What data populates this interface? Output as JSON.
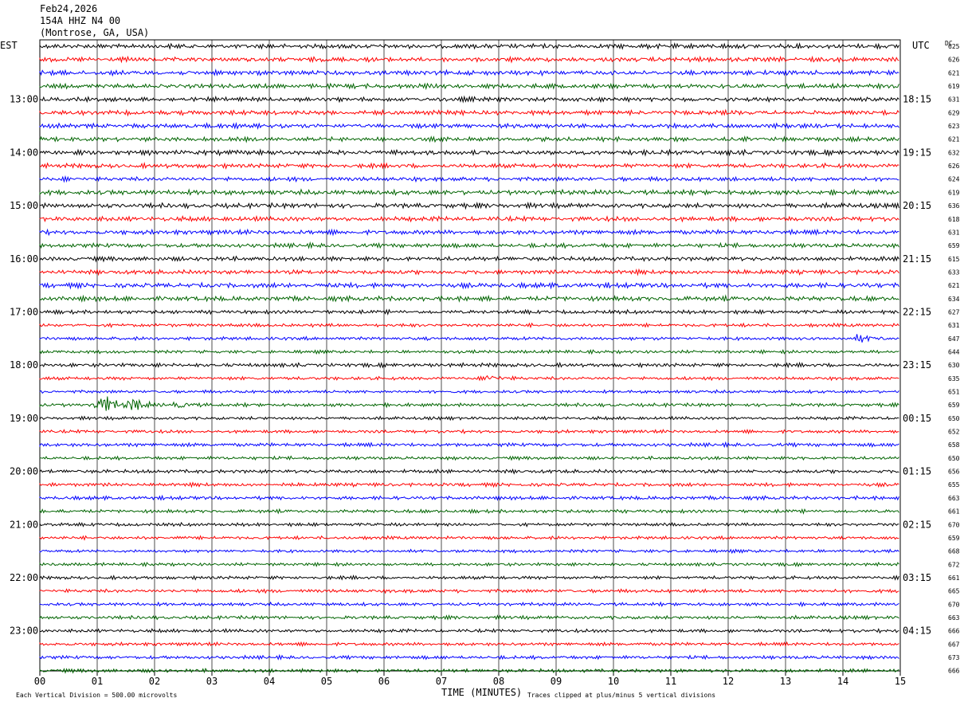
{
  "header": {
    "date": "Feb24,2026",
    "station": "154A HHZ N4 00",
    "location": "(Montrose, GA, USA)"
  },
  "left_axis_label": "EST",
  "right_axis_label": "UTC",
  "dc_label": "DC",
  "footer": {
    "scale_note": "Each Vertical Division =  500.00 microvolts",
    "xlabel": "TIME (MINUTES)",
    "clip_note": "Traces clipped at plus/minus 5 vertical divisions"
  },
  "chart_data": {
    "type": "line",
    "title": "",
    "xlabel": "TIME (MINUTES)",
    "x_ticks": [
      "00",
      "01",
      "02",
      "03",
      "04",
      "05",
      "06",
      "07",
      "08",
      "09",
      "10",
      "11",
      "12",
      "13",
      "14",
      "15"
    ],
    "xlim": [
      0,
      15
    ],
    "trace_colors": [
      "#000000",
      "#ff0000",
      "#0000ff",
      "#006400"
    ],
    "est_labels": [
      "13:00",
      "14:00",
      "15:00",
      "16:00",
      "17:00",
      "18:00",
      "19:00",
      "20:00",
      "21:00",
      "22:00",
      "23:00"
    ],
    "utc_labels": [
      "18:15",
      "19:15",
      "20:15",
      "21:15",
      "22:15",
      "23:15",
      "00:15",
      "01:15",
      "02:15",
      "03:15",
      "04:15"
    ],
    "dc_values": [
      625,
      626,
      621,
      619,
      631,
      629,
      623,
      621,
      632,
      626,
      624,
      619,
      636,
      618,
      631,
      659,
      615,
      633,
      621,
      634,
      627,
      631,
      647,
      644,
      630,
      635,
      651,
      659,
      650,
      652,
      658,
      650,
      656,
      655,
      663,
      661,
      670,
      659,
      668,
      672,
      661,
      665,
      670,
      663,
      666,
      667,
      673,
      666
    ],
    "events": [
      {
        "trace": 27,
        "minute": 1.0,
        "amplitude": "large"
      },
      {
        "trace": 27,
        "minute": 1.55,
        "amplitude": "medium"
      },
      {
        "trace": 27,
        "minute": 2.35,
        "amplitude": "small"
      },
      {
        "trace": 25,
        "minute": 7.8,
        "amplitude": "small"
      },
      {
        "trace": 22,
        "minute": 14.25,
        "amplitude": "small"
      }
    ]
  }
}
